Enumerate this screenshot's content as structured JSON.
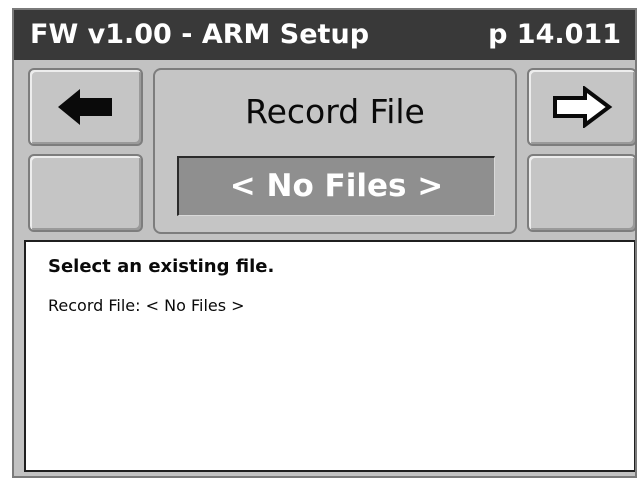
{
  "titlebar": {
    "title": "FW v1.00 - ARM Setup",
    "page": "p 14.011"
  },
  "panel": {
    "title": "Record File",
    "value": "< No Files >"
  },
  "info": {
    "heading": "Select an existing file.",
    "line_label": "Record File:",
    "line_value": "< No Files >"
  },
  "icons": {
    "back": "arrow-left-filled-icon",
    "forward": "arrow-right-outline-icon"
  },
  "colors": {
    "titlebar_bg": "#393939",
    "screen_bg": "#c2c2c2",
    "value_box_bg": "#8f8f8f"
  }
}
